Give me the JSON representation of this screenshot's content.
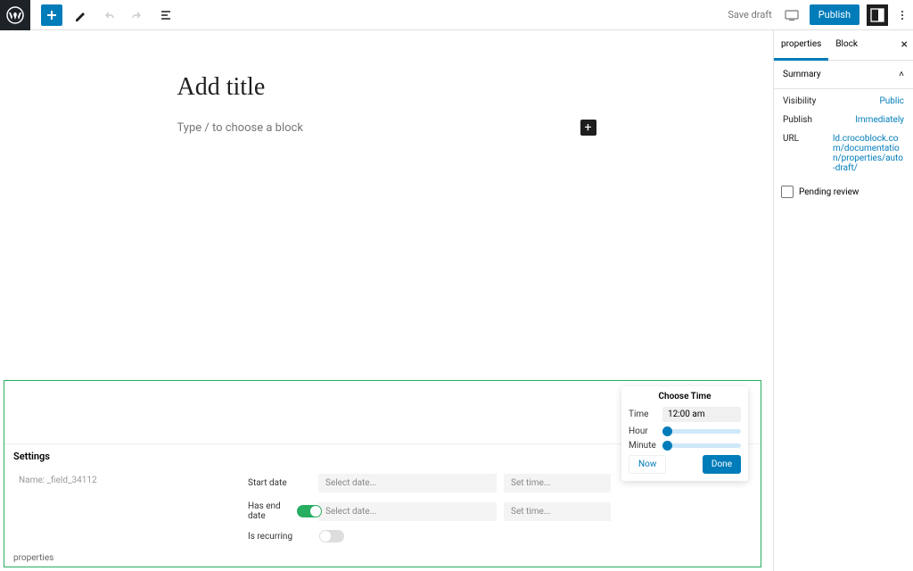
{
  "toolbar": {
    "save_draft": "Save draft",
    "publish": "Publish"
  },
  "editor": {
    "title_placeholder": "Add title",
    "block_placeholder": "Type / to choose a block"
  },
  "sidebar": {
    "tabs": {
      "properties": "properties",
      "block": "Block"
    },
    "summary": {
      "title": "Summary",
      "visibility_label": "Visibility",
      "visibility_value": "Public",
      "publish_label": "Publish",
      "publish_value": "Immediately",
      "url_label": "URL",
      "url_value": "ld.crocoblock.com/documentation/properties/auto-draft/",
      "pending_review": "Pending review"
    }
  },
  "timepicker": {
    "title": "Choose Time",
    "time_label": "Time",
    "time_value": "12:00 am",
    "hour_label": "Hour",
    "minute_label": "Minute",
    "now": "Now",
    "done": "Done"
  },
  "settings_panel": {
    "title": "Settings",
    "name_field": "Name: _field_34112",
    "start_date_label": "Start date",
    "select_date": "Select date...",
    "set_time": "Set time...",
    "has_end_date_label": "Has end date",
    "is_recurring_label": "Is recurring",
    "bottom_label": "properties"
  }
}
